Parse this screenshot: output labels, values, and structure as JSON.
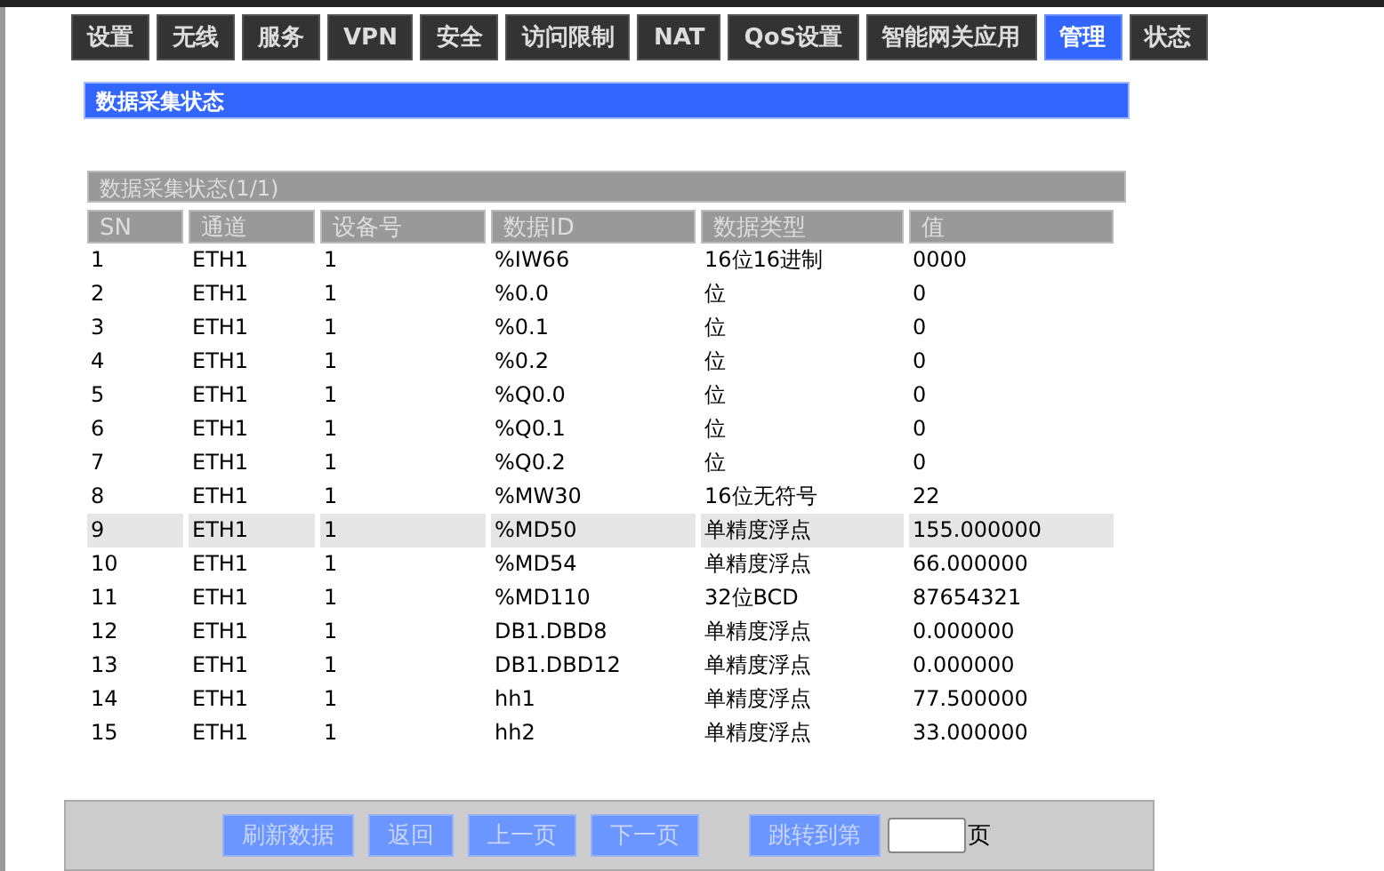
{
  "tabs": [
    {
      "label": "设置",
      "selected": false
    },
    {
      "label": "无线",
      "selected": false
    },
    {
      "label": "服务",
      "selected": false
    },
    {
      "label": "VPN",
      "selected": false
    },
    {
      "label": "安全",
      "selected": false
    },
    {
      "label": "访问限制",
      "selected": false
    },
    {
      "label": "NAT",
      "selected": false
    },
    {
      "label": "QoS设置",
      "selected": false
    },
    {
      "label": "智能网关应用",
      "selected": false
    },
    {
      "label": "管理",
      "selected": true
    },
    {
      "label": "状态",
      "selected": false
    }
  ],
  "panel": {
    "title": "数据采集状态"
  },
  "table": {
    "caption": "数据采集状态(1/1)",
    "columns": [
      "SN",
      "通道",
      "设备号",
      "数据ID",
      "数据类型",
      "值"
    ],
    "rows": [
      {
        "cells": [
          "1",
          "ETH1",
          "1",
          "%IW66",
          "16位16进制",
          "0000"
        ],
        "highlighted": false
      },
      {
        "cells": [
          "2",
          "ETH1",
          "1",
          "%0.0",
          "位",
          "0"
        ],
        "highlighted": false
      },
      {
        "cells": [
          "3",
          "ETH1",
          "1",
          "%0.1",
          "位",
          "0"
        ],
        "highlighted": false
      },
      {
        "cells": [
          "4",
          "ETH1",
          "1",
          "%0.2",
          "位",
          "0"
        ],
        "highlighted": false
      },
      {
        "cells": [
          "5",
          "ETH1",
          "1",
          "%Q0.0",
          "位",
          "0"
        ],
        "highlighted": false
      },
      {
        "cells": [
          "6",
          "ETH1",
          "1",
          "%Q0.1",
          "位",
          "0"
        ],
        "highlighted": false
      },
      {
        "cells": [
          "7",
          "ETH1",
          "1",
          "%Q0.2",
          "位",
          "0"
        ],
        "highlighted": false
      },
      {
        "cells": [
          "8",
          "ETH1",
          "1",
          "%MW30",
          "16位无符号",
          "22"
        ],
        "highlighted": false
      },
      {
        "cells": [
          "9",
          "ETH1",
          "1",
          "%MD50",
          "单精度浮点",
          "155.000000"
        ],
        "highlighted": true
      },
      {
        "cells": [
          "10",
          "ETH1",
          "1",
          "%MD54",
          "单精度浮点",
          "66.000000"
        ],
        "highlighted": false
      },
      {
        "cells": [
          "11",
          "ETH1",
          "1",
          "%MD110",
          "32位BCD",
          "87654321"
        ],
        "highlighted": false
      },
      {
        "cells": [
          "12",
          "ETH1",
          "1",
          "DB1.DBD8",
          "单精度浮点",
          "0.000000"
        ],
        "highlighted": false
      },
      {
        "cells": [
          "13",
          "ETH1",
          "1",
          "DB1.DBD12",
          "单精度浮点",
          "0.000000"
        ],
        "highlighted": false
      },
      {
        "cells": [
          "14",
          "ETH1",
          "1",
          "hh1",
          "单精度浮点",
          "77.500000"
        ],
        "highlighted": false
      },
      {
        "cells": [
          "15",
          "ETH1",
          "1",
          "hh2",
          "单精度浮点",
          "33.000000"
        ],
        "highlighted": false
      }
    ]
  },
  "footer": {
    "buttons": [
      {
        "label": "刷新数据",
        "disabled": true
      },
      {
        "label": "返回",
        "disabled": true
      },
      {
        "label": "上一页",
        "disabled": true
      },
      {
        "label": "下一页",
        "disabled": true
      },
      {
        "label": "跳转到第",
        "disabled": true
      }
    ],
    "page_suffix": "页"
  }
}
